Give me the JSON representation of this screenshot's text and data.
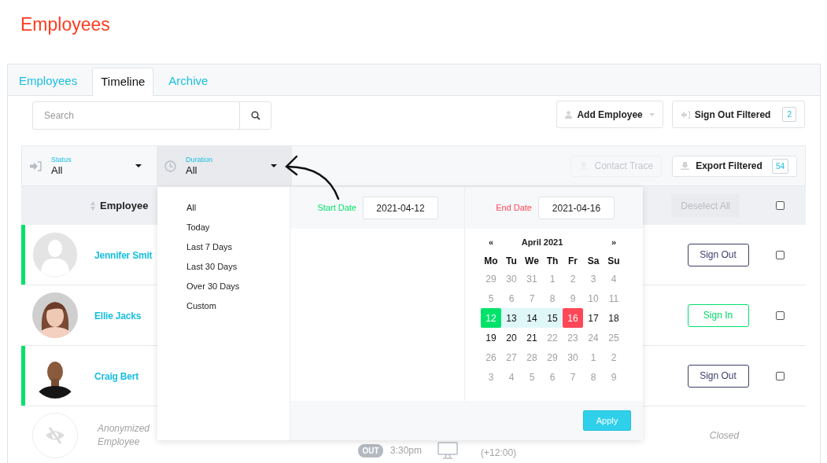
{
  "page_title": "Employees",
  "tabs": [
    {
      "label": "Employees",
      "selected": false
    },
    {
      "label": "Timeline",
      "selected": true
    },
    {
      "label": "Archive",
      "selected": false
    }
  ],
  "search": {
    "placeholder": "Search"
  },
  "toolbar_buttons": [
    {
      "label": "Add Employee",
      "kind": "add"
    },
    {
      "label": "Sign Out Filtered",
      "kind": "sign_out",
      "count": "2"
    }
  ],
  "filters": [
    {
      "label": "Status",
      "value": "All",
      "kind": "status",
      "expanded": false
    },
    {
      "label": "Duration",
      "value": "All",
      "kind": "duration",
      "expanded": true
    }
  ],
  "actions": [
    {
      "label": "Contact Trace",
      "disabled": true
    },
    {
      "label": "Export Filtered",
      "disabled": false,
      "count": "54"
    }
  ],
  "table": {
    "columns": [
      "Employee"
    ],
    "deselect_label": "Deselect All",
    "deselect_disabled": true,
    "all_checked": false,
    "rows": [
      {
        "kind": "employee",
        "name": "Jennifer Smit",
        "avatar": {
          "kind": "placeholder"
        },
        "active": true,
        "action": {
          "label": "Sign Out",
          "kind": "sign_out"
        },
        "checked": false
      },
      {
        "kind": "employee",
        "name": "Ellie Jacks",
        "active": false,
        "action": {
          "label": "Sign In",
          "kind": "sign_in"
        },
        "checked": false
      },
      {
        "kind": "employee",
        "name": "Craig Bert",
        "avatar": {
          "kind": "photo_dark"
        },
        "active": true,
        "action": {
          "label": "Sign Out",
          "kind": "sign_out"
        },
        "checked": false
      },
      {
        "kind": "anonymized",
        "name": "Anonymized Employee",
        "active": false,
        "badge": "OUT",
        "time": "3:30pm",
        "offset": "(+12:00)",
        "status": "Closed"
      }
    ]
  },
  "duration_menu": {
    "items": [
      "All",
      "Today",
      "Last 7 Days",
      "Last 30 Days",
      "Over 30 Days",
      "Custom"
    ]
  },
  "date_range": {
    "start_label": "Start Date",
    "start_value": "2021-04-12",
    "end_label": "End Date",
    "end_value": "2021-04-16",
    "prev": "«",
    "month": "April 2021",
    "next": "»",
    "weekdays": [
      "Mo",
      "Tu",
      "We",
      "Th",
      "Fr",
      "Sa",
      "Su"
    ],
    "days": [
      {
        "label": "29",
        "muted": true
      },
      {
        "label": "30",
        "muted": true
      },
      {
        "label": "31",
        "muted": true
      },
      {
        "label": "1",
        "muted": true
      },
      {
        "label": "2",
        "muted": true
      },
      {
        "label": "3",
        "muted": true
      },
      {
        "label": "4",
        "muted": true
      },
      {
        "label": "5",
        "muted": true
      },
      {
        "label": "6",
        "muted": true
      },
      {
        "label": "7",
        "muted": true
      },
      {
        "label": "8",
        "muted": true
      },
      {
        "label": "9",
        "muted": true
      },
      {
        "label": "10",
        "muted": true
      },
      {
        "label": "11",
        "muted": true
      },
      {
        "label": "12",
        "muted": false,
        "kind": "start"
      },
      {
        "label": "13",
        "muted": false,
        "kind": "range"
      },
      {
        "label": "14",
        "muted": false,
        "kind": "range"
      },
      {
        "label": "15",
        "muted": false,
        "kind": "range"
      },
      {
        "label": "16",
        "muted": false,
        "kind": "end"
      },
      {
        "label": "17",
        "muted": false
      },
      {
        "label": "18",
        "muted": false
      },
      {
        "label": "19",
        "muted": false
      },
      {
        "label": "20",
        "muted": false
      },
      {
        "label": "21",
        "muted": false
      },
      {
        "label": "22",
        "muted": true
      },
      {
        "label": "23",
        "muted": true
      },
      {
        "label": "24",
        "muted": true
      },
      {
        "label": "25",
        "muted": true
      },
      {
        "label": "26",
        "muted": true
      },
      {
        "label": "27",
        "muted": true
      },
      {
        "label": "28",
        "muted": true
      },
      {
        "label": "29",
        "muted": true
      },
      {
        "label": "30",
        "muted": true
      },
      {
        "label": "1",
        "muted": true
      },
      {
        "label": "2",
        "muted": true
      },
      {
        "label": "3",
        "muted": true
      },
      {
        "label": "4",
        "muted": true
      },
      {
        "label": "5",
        "muted": true
      },
      {
        "label": "6",
        "muted": true
      },
      {
        "label": "7",
        "muted": true
      },
      {
        "label": "8",
        "muted": true
      },
      {
        "label": "9",
        "muted": true
      }
    ],
    "apply": "Apply"
  }
}
